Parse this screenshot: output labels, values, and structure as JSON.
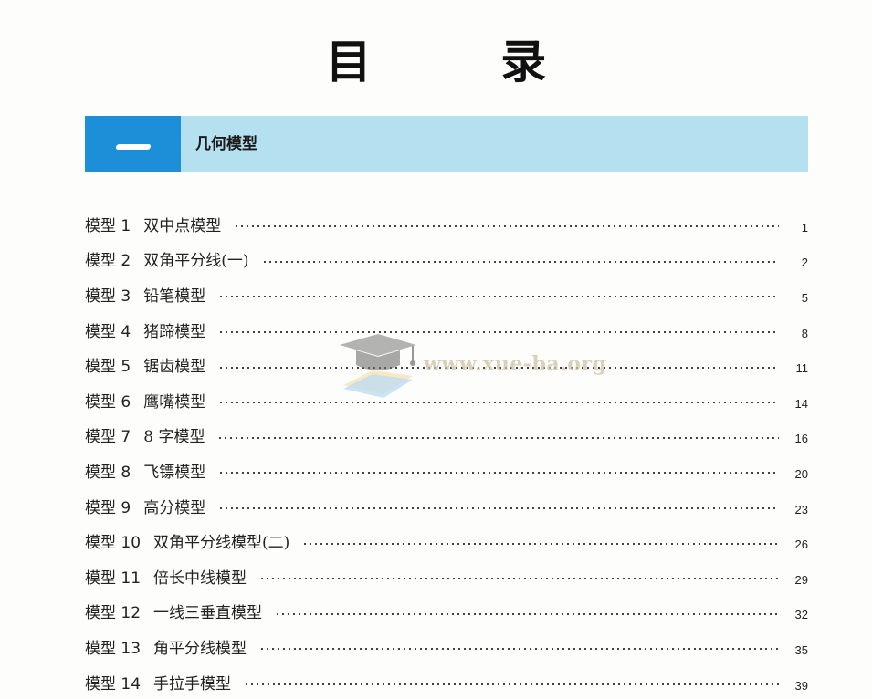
{
  "page_title": "目 录",
  "section": {
    "number": "一",
    "title": "几何模型"
  },
  "toc": [
    {
      "label": "模型 1",
      "name": "双中点模型",
      "page": "1"
    },
    {
      "label": "模型 2",
      "name": "双角平分线(一)",
      "page": "2"
    },
    {
      "label": "模型 3",
      "name": "铅笔模型",
      "page": "5"
    },
    {
      "label": "模型 4",
      "name": "猪蹄模型",
      "page": "8"
    },
    {
      "label": "模型 5",
      "name": "锯齿模型",
      "page": "11"
    },
    {
      "label": "模型 6",
      "name": "鹰嘴模型",
      "page": "14"
    },
    {
      "label": "模型 7",
      "name": "8 字模型",
      "page": "16"
    },
    {
      "label": "模型 8",
      "name": "飞镖模型",
      "page": "20"
    },
    {
      "label": "模型 9",
      "name": "高分模型",
      "page": "23"
    },
    {
      "label": "模型 10",
      "name": "双角平分线模型(二)",
      "page": "26"
    },
    {
      "label": "模型 11",
      "name": "倍长中线模型",
      "page": "29"
    },
    {
      "label": "模型 12",
      "name": "一线三垂直模型",
      "page": "32"
    },
    {
      "label": "模型 13",
      "name": "角平分线模型",
      "page": "35"
    },
    {
      "label": "模型 14",
      "name": "手拉手模型",
      "page": "39"
    }
  ],
  "watermark": {
    "text": "www.xue-ba.org",
    "icon": "graduation-cap-book-icon"
  }
}
